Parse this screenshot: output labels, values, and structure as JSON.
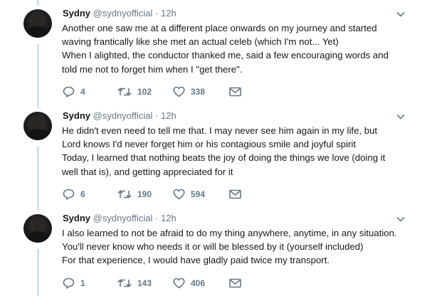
{
  "tweets": [
    {
      "name": "Sydny",
      "handle": "@sydnyofficial",
      "separator": "·",
      "time": "12h",
      "lines": [
        "Another one saw me at a different place onwards on my journey and started",
        "waving frantically like she met an actual celeb (which I'm not... Yet)",
        "When I alighted, the conductor thanked me, said a few encouraging words and",
        "told me not to forget him when I \"get there\"."
      ],
      "replies": "4",
      "retweets": "102",
      "likes": "338"
    },
    {
      "name": "Sydny",
      "handle": "@sydnyofficial",
      "separator": "·",
      "time": "12h",
      "lines": [
        "He didn't even need to tell me that. I may never see him again in my life, but",
        "Lord knows I'd never forget him or his contagious smile and joyful spirit",
        "Today, I learned that nothing beats the joy of doing the things we love (doing it",
        "well that is), and getting appreciated for it"
      ],
      "replies": "6",
      "retweets": "190",
      "likes": "594"
    },
    {
      "name": "Sydny",
      "handle": "@sydnyofficial",
      "separator": "·",
      "time": "12h",
      "lines": [
        "I also learned to not be afraid to do my thing anywhere, anytime, in any situation.",
        "You'll never know who needs it or will be blessed by it (yourself included)",
        "For that experience, I would have gladly paid twice my transport."
      ],
      "replies": "1",
      "retweets": "143",
      "likes": "406"
    }
  ],
  "icons": {
    "reply": "reply-icon",
    "retweet": "retweet-icon",
    "like": "heart-icon",
    "message": "envelope-icon",
    "menu": "chevron-down-icon"
  },
  "colors": {
    "thread_line": "#cfe3f4",
    "meta": "#657786",
    "text": "#14171a"
  }
}
